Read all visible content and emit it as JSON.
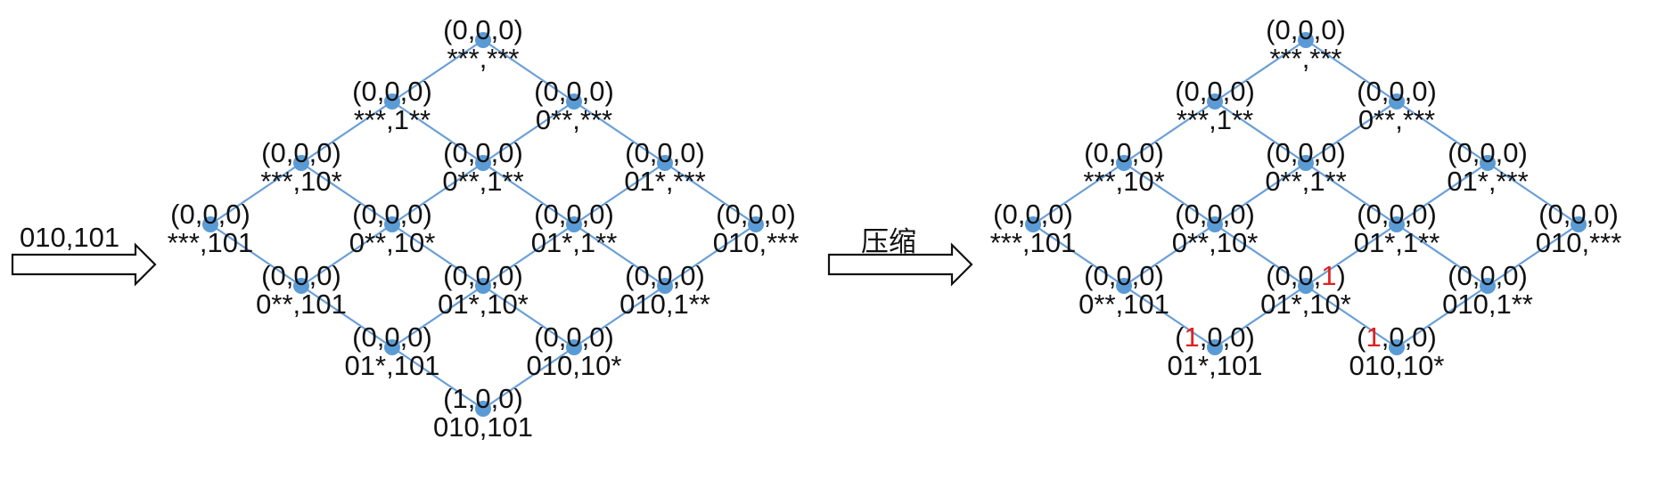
{
  "input_label": "010,101",
  "compress_label": "压缩",
  "colors": {
    "edge": "#6a9fd8",
    "node": "#5b9bd5",
    "highlight": "#e02020",
    "text": "#111111"
  },
  "lattices": [
    {
      "name": "before",
      "nodes": [
        {
          "id": "top",
          "counts": [
            "0",
            "0",
            "0"
          ],
          "mask": "***,***"
        },
        {
          "id": "a1",
          "counts": [
            "0",
            "0",
            "0"
          ],
          "mask": "***,1**"
        },
        {
          "id": "b1",
          "counts": [
            "0",
            "0",
            "0"
          ],
          "mask": "0**,***"
        },
        {
          "id": "a2",
          "counts": [
            "0",
            "0",
            "0"
          ],
          "mask": "***,10*"
        },
        {
          "id": "ab",
          "counts": [
            "0",
            "0",
            "0"
          ],
          "mask": "0**,1**"
        },
        {
          "id": "b2",
          "counts": [
            "0",
            "0",
            "0"
          ],
          "mask": "01*,***"
        },
        {
          "id": "a3",
          "counts": [
            "0",
            "0",
            "0"
          ],
          "mask": "***,101"
        },
        {
          "id": "a2b",
          "counts": [
            "0",
            "0",
            "0"
          ],
          "mask": "0**,10*"
        },
        {
          "id": "ab2",
          "counts": [
            "0",
            "0",
            "0"
          ],
          "mask": "01*,1**"
        },
        {
          "id": "b3",
          "counts": [
            "0",
            "0",
            "0"
          ],
          "mask": "010,***"
        },
        {
          "id": "a3b",
          "counts": [
            "0",
            "0",
            "0"
          ],
          "mask": "0**,101"
        },
        {
          "id": "a2b2",
          "counts": [
            "0",
            "0",
            "0"
          ],
          "mask": "01*,10*"
        },
        {
          "id": "ab3",
          "counts": [
            "0",
            "0",
            "0"
          ],
          "mask": "010,1**"
        },
        {
          "id": "a3b2",
          "counts": [
            "0",
            "0",
            "0"
          ],
          "mask": "01*,101"
        },
        {
          "id": "a2b3",
          "counts": [
            "0",
            "0",
            "0"
          ],
          "mask": "010,10*"
        },
        {
          "id": "bottom",
          "counts": [
            "1",
            "0",
            "0"
          ],
          "mask": "010,101"
        }
      ]
    },
    {
      "name": "after",
      "nodes": [
        {
          "id": "top",
          "counts": [
            "0",
            "0",
            "0"
          ],
          "mask": "***,***"
        },
        {
          "id": "a1",
          "counts": [
            "0",
            "0",
            "0"
          ],
          "mask": "***,1**"
        },
        {
          "id": "b1",
          "counts": [
            "0",
            "0",
            "0"
          ],
          "mask": "0**,***"
        },
        {
          "id": "a2",
          "counts": [
            "0",
            "0",
            "0"
          ],
          "mask": "***,10*"
        },
        {
          "id": "ab",
          "counts": [
            "0",
            "0",
            "0"
          ],
          "mask": "0**,1**"
        },
        {
          "id": "b2",
          "counts": [
            "0",
            "0",
            "0"
          ],
          "mask": "01*,***"
        },
        {
          "id": "a3",
          "counts": [
            "0",
            "0",
            "0"
          ],
          "mask": "***,101"
        },
        {
          "id": "a2b",
          "counts": [
            "0",
            "0",
            "0"
          ],
          "mask": "0**,10*"
        },
        {
          "id": "ab2",
          "counts": [
            "0",
            "0",
            "0"
          ],
          "mask": "01*,1**"
        },
        {
          "id": "b3",
          "counts": [
            "0",
            "0",
            "0"
          ],
          "mask": "010,***"
        },
        {
          "id": "a3b",
          "counts": [
            "0",
            "0",
            "0"
          ],
          "mask": "0**,101"
        },
        {
          "id": "a2b2",
          "counts": [
            "0",
            "0",
            "1"
          ],
          "mask": "01*,10*",
          "highlight": 2
        },
        {
          "id": "ab3",
          "counts": [
            "0",
            "0",
            "0"
          ],
          "mask": "010,1**"
        },
        {
          "id": "a3b2",
          "counts": [
            "1",
            "0",
            "0"
          ],
          "mask": "01*,101",
          "highlight": 0
        },
        {
          "id": "a2b3",
          "counts": [
            "1",
            "0",
            "0"
          ],
          "mask": "010,10*",
          "highlight": 0
        }
      ]
    }
  ]
}
